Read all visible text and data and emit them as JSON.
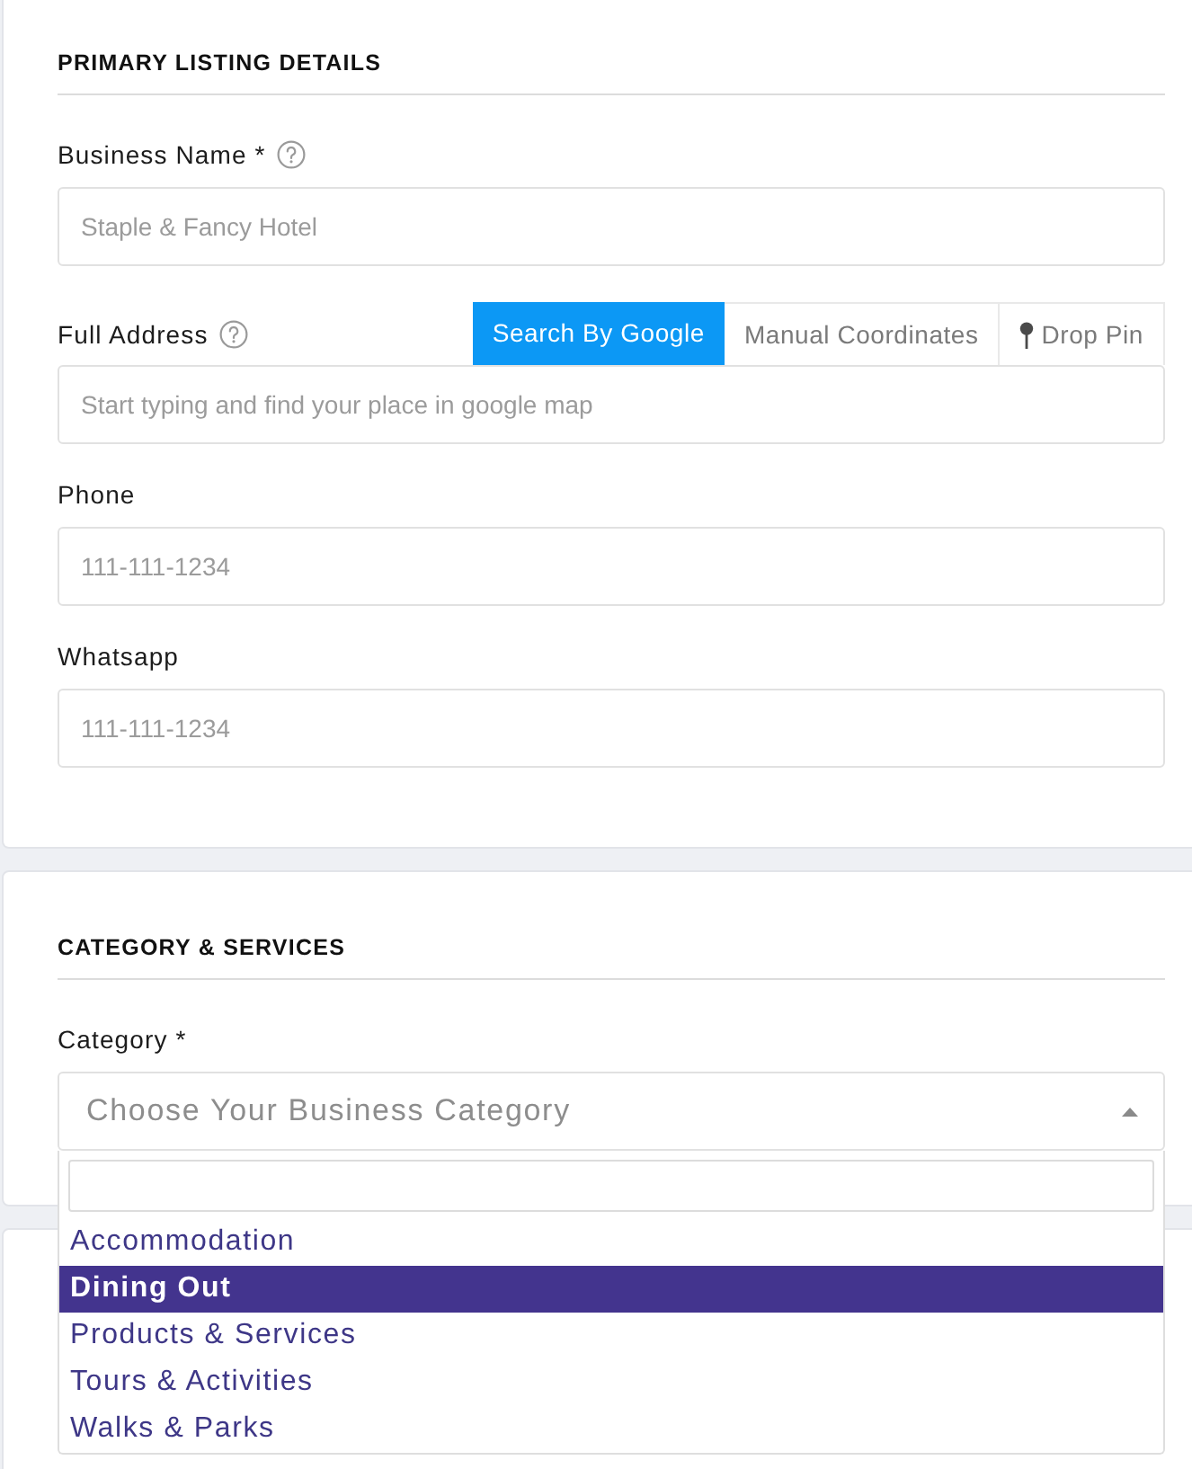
{
  "sections": [
    {
      "title": "PRIMARY LISTING DETAILS",
      "fields": [
        {
          "kind": "text",
          "label": "Business Name *",
          "help": true,
          "placeholder": "Staple & Fancy Hotel"
        },
        {
          "kind": "address",
          "label": "Full Address",
          "help": true,
          "tabs": [
            {
              "label": "Search By Google",
              "selected": true,
              "icon": false
            },
            {
              "label": "Manual Coordinates",
              "selected": false,
              "icon": false
            },
            {
              "label": "Drop Pin",
              "selected": false,
              "icon": true
            }
          ],
          "placeholder": "Start typing and find your place in google map"
        },
        {
          "kind": "text",
          "label": "Phone",
          "placeholder": "111-111-1234"
        },
        {
          "kind": "text",
          "label": "Whatsapp",
          "placeholder": "111-111-1234"
        }
      ]
    },
    {
      "title": "CATEGORY & SERVICES",
      "fields": [
        {
          "kind": "select",
          "label": "Category *",
          "placeholder": "Choose Your Business Category",
          "expanded": true,
          "options": [
            {
              "label": "Accommodation",
              "selected": false
            },
            {
              "label": "Dining Out",
              "selected": true
            },
            {
              "label": "Products & Services",
              "selected": false
            },
            {
              "label": "Tours & Activities",
              "selected": false
            },
            {
              "label": "Walks & Parks",
              "selected": false
            }
          ]
        }
      ]
    }
  ]
}
